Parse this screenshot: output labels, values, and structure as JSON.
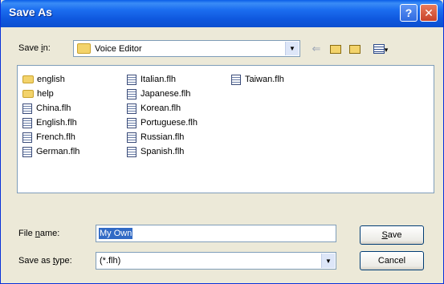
{
  "window": {
    "title": "Save As",
    "help_glyph": "?",
    "close_glyph": "✕"
  },
  "save_in": {
    "label_pre": "Save ",
    "label_underlined": "i",
    "label_post": "n:",
    "value": "Voice Editor",
    "icons": [
      "back-arrow-icon",
      "up-folder-icon",
      "new-folder-icon",
      "view-menu-icon"
    ]
  },
  "files": {
    "column1": [
      {
        "name": "english",
        "type": "folder"
      },
      {
        "name": "help",
        "type": "folder"
      },
      {
        "name": "China.flh",
        "type": "file"
      },
      {
        "name": "English.flh",
        "type": "file"
      },
      {
        "name": "French.flh",
        "type": "file"
      },
      {
        "name": "German.flh",
        "type": "file"
      }
    ],
    "column2": [
      {
        "name": "Italian.flh",
        "type": "file"
      },
      {
        "name": "Japanese.flh",
        "type": "file"
      },
      {
        "name": "Korean.flh",
        "type": "file"
      },
      {
        "name": "Portuguese.flh",
        "type": "file"
      },
      {
        "name": "Russian.flh",
        "type": "file"
      },
      {
        "name": "Spanish.flh",
        "type": "file"
      }
    ],
    "column3": [
      {
        "name": "Taiwan.flh",
        "type": "file"
      }
    ]
  },
  "file_name": {
    "label_pre": "File ",
    "label_underlined": "n",
    "label_post": "ame:",
    "value": "My Own"
  },
  "save_type": {
    "label_pre": "Save as ",
    "label_underlined": "t",
    "label_post": "ype:",
    "value": "(*.flh)"
  },
  "buttons": {
    "save_underlined": "S",
    "save_rest": "ave",
    "cancel": "Cancel"
  },
  "colors": {
    "title_bar": "#0c58de",
    "selection": "#316ac5",
    "dialog_bg": "#ece9d8"
  }
}
